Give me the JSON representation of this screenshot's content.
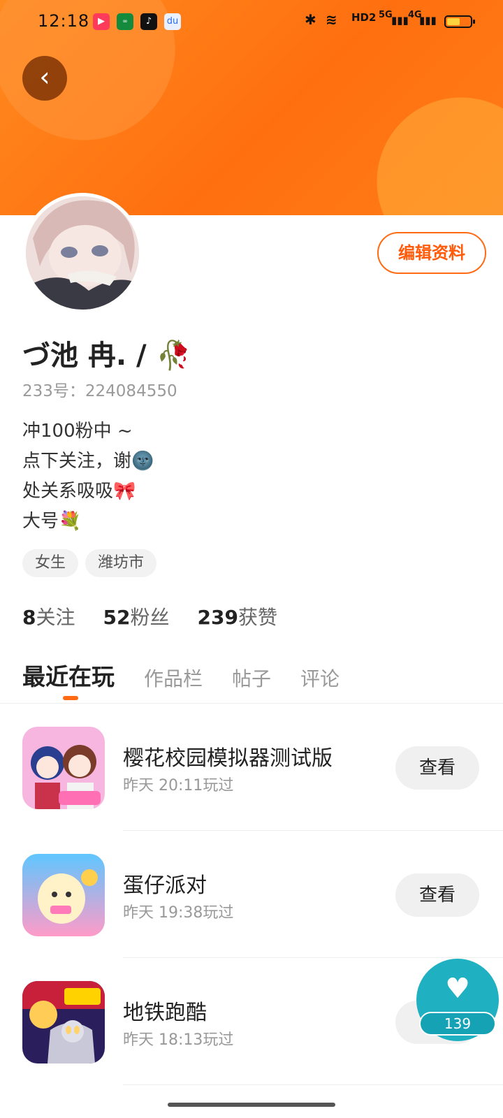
{
  "status_bar": {
    "time": "12:18",
    "network_labels": [
      "HD2",
      "5G",
      "4G"
    ],
    "battery_percent": 55
  },
  "profile": {
    "name": "づ池 冉. / 🥀",
    "id_line": "233号：224084550",
    "edit_label": "编辑资料",
    "bio": [
      "冲100粉中 ~",
      "点下关注，谢🌚",
      "处关系吸吸🎀",
      "大号💐"
    ],
    "tags": [
      "女生",
      "潍坊市"
    ]
  },
  "stats": [
    {
      "value": "8",
      "label": "关注"
    },
    {
      "value": "52",
      "label": "粉丝"
    },
    {
      "value": "239",
      "label": "获赞"
    }
  ],
  "tabs": [
    "最近在玩",
    "作品栏",
    "帖子",
    "评论"
  ],
  "games": [
    {
      "title": "樱花校园模拟器测试版",
      "played": "昨天 20:11玩过",
      "button": "查看"
    },
    {
      "title": "蛋仔派对",
      "played": "昨天 19:38玩过",
      "button": "查看"
    },
    {
      "title": "地铁跑酷",
      "played": "昨天 18:13玩过",
      "button": "查看"
    }
  ],
  "fab": {
    "count": "139"
  },
  "colors": {
    "accent": "#ff6a13",
    "banner": "#ff7a18",
    "fab": "#1fb0c1"
  }
}
